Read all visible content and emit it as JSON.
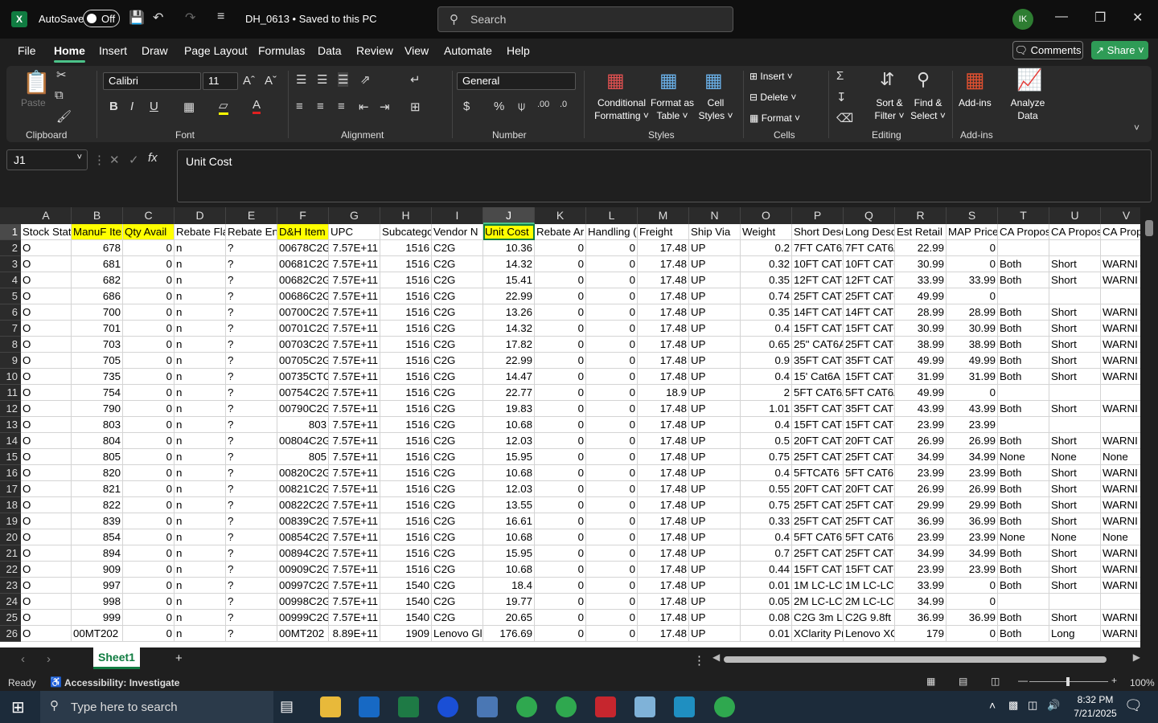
{
  "titlebar": {
    "autosave_label": "AutoSave",
    "autosave_state": "Off",
    "doc_title": "DH_0613 • Saved to this PC",
    "search_placeholder": "Search",
    "avatar_initials": "IK"
  },
  "menu": {
    "items": [
      "File",
      "Home",
      "Insert",
      "Draw",
      "Page Layout",
      "Formulas",
      "Data",
      "Review",
      "View",
      "Automate",
      "Help"
    ],
    "active": "Home",
    "comments_label": "Comments",
    "share_label": "Share"
  },
  "ribbon": {
    "groups": [
      "Clipboard",
      "Font",
      "Alignment",
      "Number",
      "Styles",
      "Cells",
      "Editing",
      "Add-ins"
    ],
    "paste_label": "Paste",
    "font_name": "Calibri",
    "font_size": "11",
    "number_format": "General",
    "conditional_formatting": [
      "Conditional",
      "Formatting"
    ],
    "format_as_table": [
      "Format as",
      "Table"
    ],
    "cell_styles": [
      "Cell",
      "Styles"
    ],
    "insert_label": "Insert",
    "delete_label": "Delete",
    "format_label": "Format",
    "sort_filter": [
      "Sort &",
      "Filter"
    ],
    "find_select": [
      "Find &",
      "Select"
    ],
    "addins_label": "Add-ins",
    "analyze_data": [
      "Analyze",
      "Data"
    ]
  },
  "formula_bar": {
    "name_box": "J1",
    "content": "Unit Cost"
  },
  "sheet": {
    "columns": [
      "A",
      "B",
      "C",
      "D",
      "E",
      "F",
      "G",
      "H",
      "I",
      "J",
      "K",
      "L",
      "M",
      "N",
      "O",
      "P",
      "Q",
      "R",
      "S",
      "T",
      "U",
      "V"
    ],
    "selected_column": "J",
    "selected_row": "1",
    "headers": [
      "Stock Stat",
      "ManuF Ite",
      "Qty Avail",
      "Rebate Fla",
      "Rebate En",
      "D&H Item",
      "UPC",
      "Subcatego",
      "Vendor N",
      "Unit Cost",
      "Rebate Ar",
      "Handling (",
      "Freight",
      "Ship Via",
      "Weight",
      "Short Desc",
      "Long Desc",
      "Est Retail",
      "MAP Price",
      "CA Propos",
      "CA Propos",
      "CA Prop"
    ],
    "rows": [
      [
        "O",
        "678",
        "0",
        "n",
        "?",
        "00678C2G",
        "7.57E+11",
        "1516",
        "C2G",
        "10.36",
        "0",
        "0",
        "17.48",
        "UP",
        "0.2",
        "7FT CAT6A",
        "7FT CAT6A",
        "22.99",
        "0",
        "",
        "",
        ""
      ],
      [
        "O",
        "681",
        "0",
        "n",
        "?",
        "00681C2G",
        "7.57E+11",
        "1516",
        "C2G",
        "14.32",
        "0",
        "0",
        "17.48",
        "UP",
        "0.32",
        "10FT CAT6",
        "10FT CAT6",
        "30.99",
        "0",
        "Both",
        "Short",
        "WARNI"
      ],
      [
        "O",
        "682",
        "0",
        "n",
        "?",
        "00682C2G",
        "7.57E+11",
        "1516",
        "C2G",
        "15.41",
        "0",
        "0",
        "17.48",
        "UP",
        "0.35",
        "12FT CAT6",
        "12FT CAT6",
        "33.99",
        "33.99",
        "Both",
        "Short",
        "WARNI"
      ],
      [
        "O",
        "686",
        "0",
        "n",
        "?",
        "00686C2G",
        "7.57E+11",
        "1516",
        "C2G",
        "22.99",
        "0",
        "0",
        "17.48",
        "UP",
        "0.74",
        "25FT CAT6",
        "25FT CAT6",
        "49.99",
        "0",
        "",
        "",
        ""
      ],
      [
        "O",
        "700",
        "0",
        "n",
        "?",
        "00700C2G",
        "7.57E+11",
        "1516",
        "C2G",
        "13.26",
        "0",
        "0",
        "17.48",
        "UP",
        "0.35",
        "14FT CAT6",
        "14FT CAT6",
        "28.99",
        "28.99",
        "Both",
        "Short",
        "WARNI"
      ],
      [
        "O",
        "701",
        "0",
        "n",
        "?",
        "00701C2G",
        "7.57E+11",
        "1516",
        "C2G",
        "14.32",
        "0",
        "0",
        "17.48",
        "UP",
        "0.4",
        "15FT CAT6",
        "15FT CAT6",
        "30.99",
        "30.99",
        "Both",
        "Short",
        "WARNI"
      ],
      [
        "O",
        "703",
        "0",
        "n",
        "?",
        "00703C2G",
        "7.57E+11",
        "1516",
        "C2G",
        "17.82",
        "0",
        "0",
        "17.48",
        "UP",
        "0.65",
        "25\" CAT6A",
        "25FT CAT6",
        "38.99",
        "38.99",
        "Both",
        "Short",
        "WARNI"
      ],
      [
        "O",
        "705",
        "0",
        "n",
        "?",
        "00705C2G",
        "7.57E+11",
        "1516",
        "C2G",
        "22.99",
        "0",
        "0",
        "17.48",
        "UP",
        "0.9",
        "35FT CAT6",
        "35FT CAT6",
        "49.99",
        "49.99",
        "Both",
        "Short",
        "WARNI"
      ],
      [
        "O",
        "735",
        "0",
        "n",
        "?",
        "00735CTG",
        "7.57E+11",
        "1516",
        "C2G",
        "14.47",
        "0",
        "0",
        "17.48",
        "UP",
        "0.4",
        "15' Cat6A",
        "15FT CAT6",
        "31.99",
        "31.99",
        "Both",
        "Short",
        "WARNI"
      ],
      [
        "O",
        "754",
        "0",
        "n",
        "?",
        "00754C2G",
        "7.57E+11",
        "1516",
        "C2G",
        "22.77",
        "0",
        "0",
        "18.9",
        "UP",
        "2",
        "5FT CAT6A",
        "5FT CAT6A",
        "49.99",
        "0",
        "",
        "",
        ""
      ],
      [
        "O",
        "790",
        "0",
        "n",
        "?",
        "00790C2G",
        "7.57E+11",
        "1516",
        "C2G",
        "19.83",
        "0",
        "0",
        "17.48",
        "UP",
        "1.01",
        "35FT CAT6",
        "35FT CAT6",
        "43.99",
        "43.99",
        "Both",
        "Short",
        "WARNI"
      ],
      [
        "O",
        "803",
        "0",
        "n",
        "?",
        "803",
        "7.57E+11",
        "1516",
        "C2G",
        "10.68",
        "0",
        "0",
        "17.48",
        "UP",
        "0.4",
        "15FT CAT6",
        "15FT CAT6",
        "23.99",
        "23.99",
        "",
        "",
        ""
      ],
      [
        "O",
        "804",
        "0",
        "n",
        "?",
        "00804C2G",
        "7.57E+11",
        "1516",
        "C2G",
        "12.03",
        "0",
        "0",
        "17.48",
        "UP",
        "0.5",
        "20FT CAT6",
        "20FT CAT6",
        "26.99",
        "26.99",
        "Both",
        "Short",
        "WARNI"
      ],
      [
        "O",
        "805",
        "0",
        "n",
        "?",
        "805",
        "7.57E+11",
        "1516",
        "C2G",
        "15.95",
        "0",
        "0",
        "17.48",
        "UP",
        "0.75",
        "25FT CAT6",
        "25FT CAT6",
        "34.99",
        "34.99",
        "None",
        "None",
        "None"
      ],
      [
        "O",
        "820",
        "0",
        "n",
        "?",
        "00820C2G",
        "7.57E+11",
        "1516",
        "C2G",
        "10.68",
        "0",
        "0",
        "17.48",
        "UP",
        "0.4",
        "5FTCAT6 S",
        "5FT CAT6 S",
        "23.99",
        "23.99",
        "Both",
        "Short",
        "WARNI"
      ],
      [
        "O",
        "821",
        "0",
        "n",
        "?",
        "00821C2G",
        "7.57E+11",
        "1516",
        "C2G",
        "12.03",
        "0",
        "0",
        "17.48",
        "UP",
        "0.55",
        "20FT CAT6",
        "20FT CAT6",
        "26.99",
        "26.99",
        "Both",
        "Short",
        "WARNI"
      ],
      [
        "O",
        "822",
        "0",
        "n",
        "?",
        "00822C2G",
        "7.57E+11",
        "1516",
        "C2G",
        "13.55",
        "0",
        "0",
        "17.48",
        "UP",
        "0.75",
        "25FT CAT6",
        "25FT CAT6",
        "29.99",
        "29.99",
        "Both",
        "Short",
        "WARNI"
      ],
      [
        "O",
        "839",
        "0",
        "n",
        "?",
        "00839C2G",
        "7.57E+11",
        "1516",
        "C2G",
        "16.61",
        "0",
        "0",
        "17.48",
        "UP",
        "0.33",
        "25FT CAT6",
        "25FT CAT6",
        "36.99",
        "36.99",
        "Both",
        "Short",
        "WARNI"
      ],
      [
        "O",
        "854",
        "0",
        "n",
        "?",
        "00854C2G",
        "7.57E+11",
        "1516",
        "C2G",
        "10.68",
        "0",
        "0",
        "17.48",
        "UP",
        "0.4",
        "5FT CAT6 S",
        "5FT CAT6 S",
        "23.99",
        "23.99",
        "None",
        "None",
        "None"
      ],
      [
        "O",
        "894",
        "0",
        "n",
        "?",
        "00894C2G",
        "7.57E+11",
        "1516",
        "C2G",
        "15.95",
        "0",
        "0",
        "17.48",
        "UP",
        "0.7",
        "25FT CAT6",
        "25FT CAT6",
        "34.99",
        "34.99",
        "Both",
        "Short",
        "WARNI"
      ],
      [
        "O",
        "909",
        "0",
        "n",
        "?",
        "00909C2G",
        "7.57E+11",
        "1516",
        "C2G",
        "10.68",
        "0",
        "0",
        "17.48",
        "UP",
        "0.44",
        "15FT CAT6",
        "15FT CAT6",
        "23.99",
        "23.99",
        "Both",
        "Short",
        "WARNI"
      ],
      [
        "O",
        "997",
        "0",
        "n",
        "?",
        "00997C2G",
        "7.57E+11",
        "1540",
        "C2G",
        "18.4",
        "0",
        "0",
        "17.48",
        "UP",
        "0.01",
        "1M LC-LC",
        "1M LC-LC",
        "33.99",
        "0",
        "Both",
        "Short",
        "WARNI"
      ],
      [
        "O",
        "998",
        "0",
        "n",
        "?",
        "00998C2G",
        "7.57E+11",
        "1540",
        "C2G",
        "19.77",
        "0",
        "0",
        "17.48",
        "UP",
        "0.05",
        "2M LC-LC",
        "2M LC-LC",
        "34.99",
        "0",
        "",
        "",
        ""
      ],
      [
        "O",
        "999",
        "0",
        "n",
        "?",
        "00999C2G",
        "7.57E+11",
        "1540",
        "C2G",
        "20.65",
        "0",
        "0",
        "17.48",
        "UP",
        "0.08",
        "C2G 3m LC",
        "C2G 9.8ft",
        "36.99",
        "36.99",
        "Both",
        "Short",
        "WARNI"
      ],
      [
        "O",
        "00MT202",
        "0",
        "n",
        "?",
        "00MT202",
        "8.89E+11",
        "1909",
        "Lenovo Gl",
        "176.69",
        "0",
        "0",
        "17.48",
        "UP",
        "0.01",
        "XClarity Pr",
        "Lenovo XC",
        "179",
        "0",
        "Both",
        "Long",
        "WARNI"
      ]
    ]
  },
  "sheet_tabs": {
    "active": "Sheet1"
  },
  "status": {
    "ready": "Ready",
    "accessibility": "Accessibility: Investigate",
    "zoom": "100%"
  },
  "taskbar": {
    "search_placeholder": "Type here to search",
    "time": "8:32 PM",
    "date": "7/21/2025"
  }
}
